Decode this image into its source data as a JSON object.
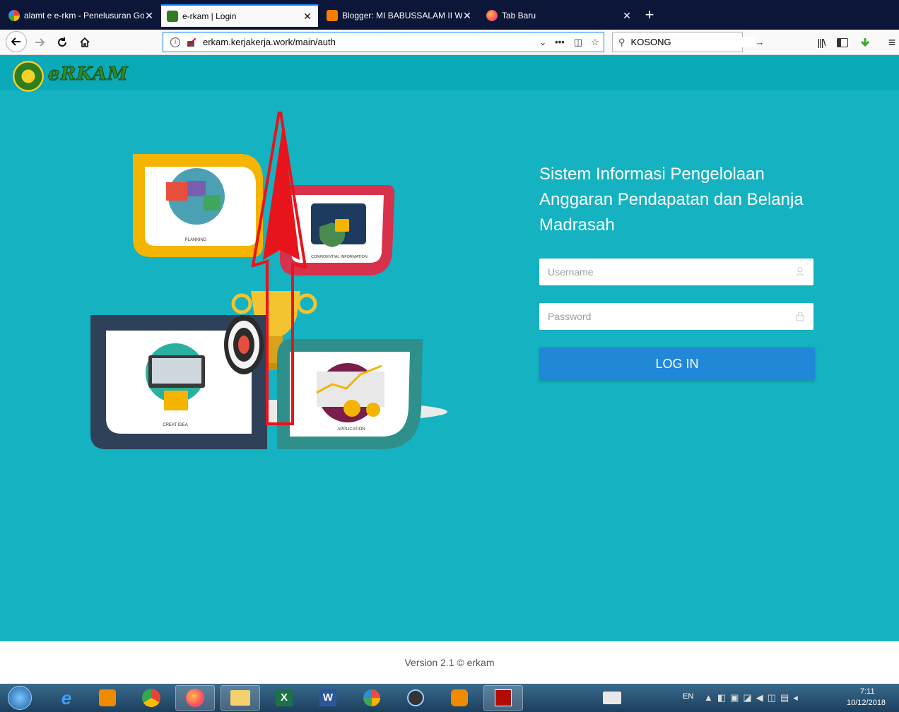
{
  "browser": {
    "tabs": [
      {
        "label": "alamt e e-rkm - Penelusuran Go",
        "icon": "google-icon"
      },
      {
        "label": "e-rkam | Login",
        "icon": "kemenag-icon",
        "active": true
      },
      {
        "label": "Blogger: MI BABUSSALAM II W",
        "icon": "blogger-icon"
      },
      {
        "label": "Tab Baru",
        "icon": "firefox-icon"
      }
    ],
    "url": "erkam.kerjakerja.work/main/auth",
    "search_value": "KOSONG"
  },
  "page": {
    "logo_text": "eRKAM",
    "title": "Sistem Informasi Pengelolaan Anggaran Pendapatan dan Belanja Madrasah",
    "username_placeholder": "Username",
    "password_placeholder": "Password",
    "login_label": "LOG IN",
    "illustration": {
      "planning": "PLANNING",
      "confidential": "CONFIDENTIAL INFORMATION",
      "creat_idea": "CREAT IDEA",
      "application": "APPLICATION"
    },
    "footer": "Version 2.1 © erkam"
  },
  "colors": {
    "page_bg": "#15b2c2",
    "header_bg": "#0aaab9",
    "login_button": "#2188d8",
    "annotation_arrow": "#e8141c"
  },
  "taskbar": {
    "language": "EN",
    "time": "7:11",
    "date": "10/12/2018"
  }
}
